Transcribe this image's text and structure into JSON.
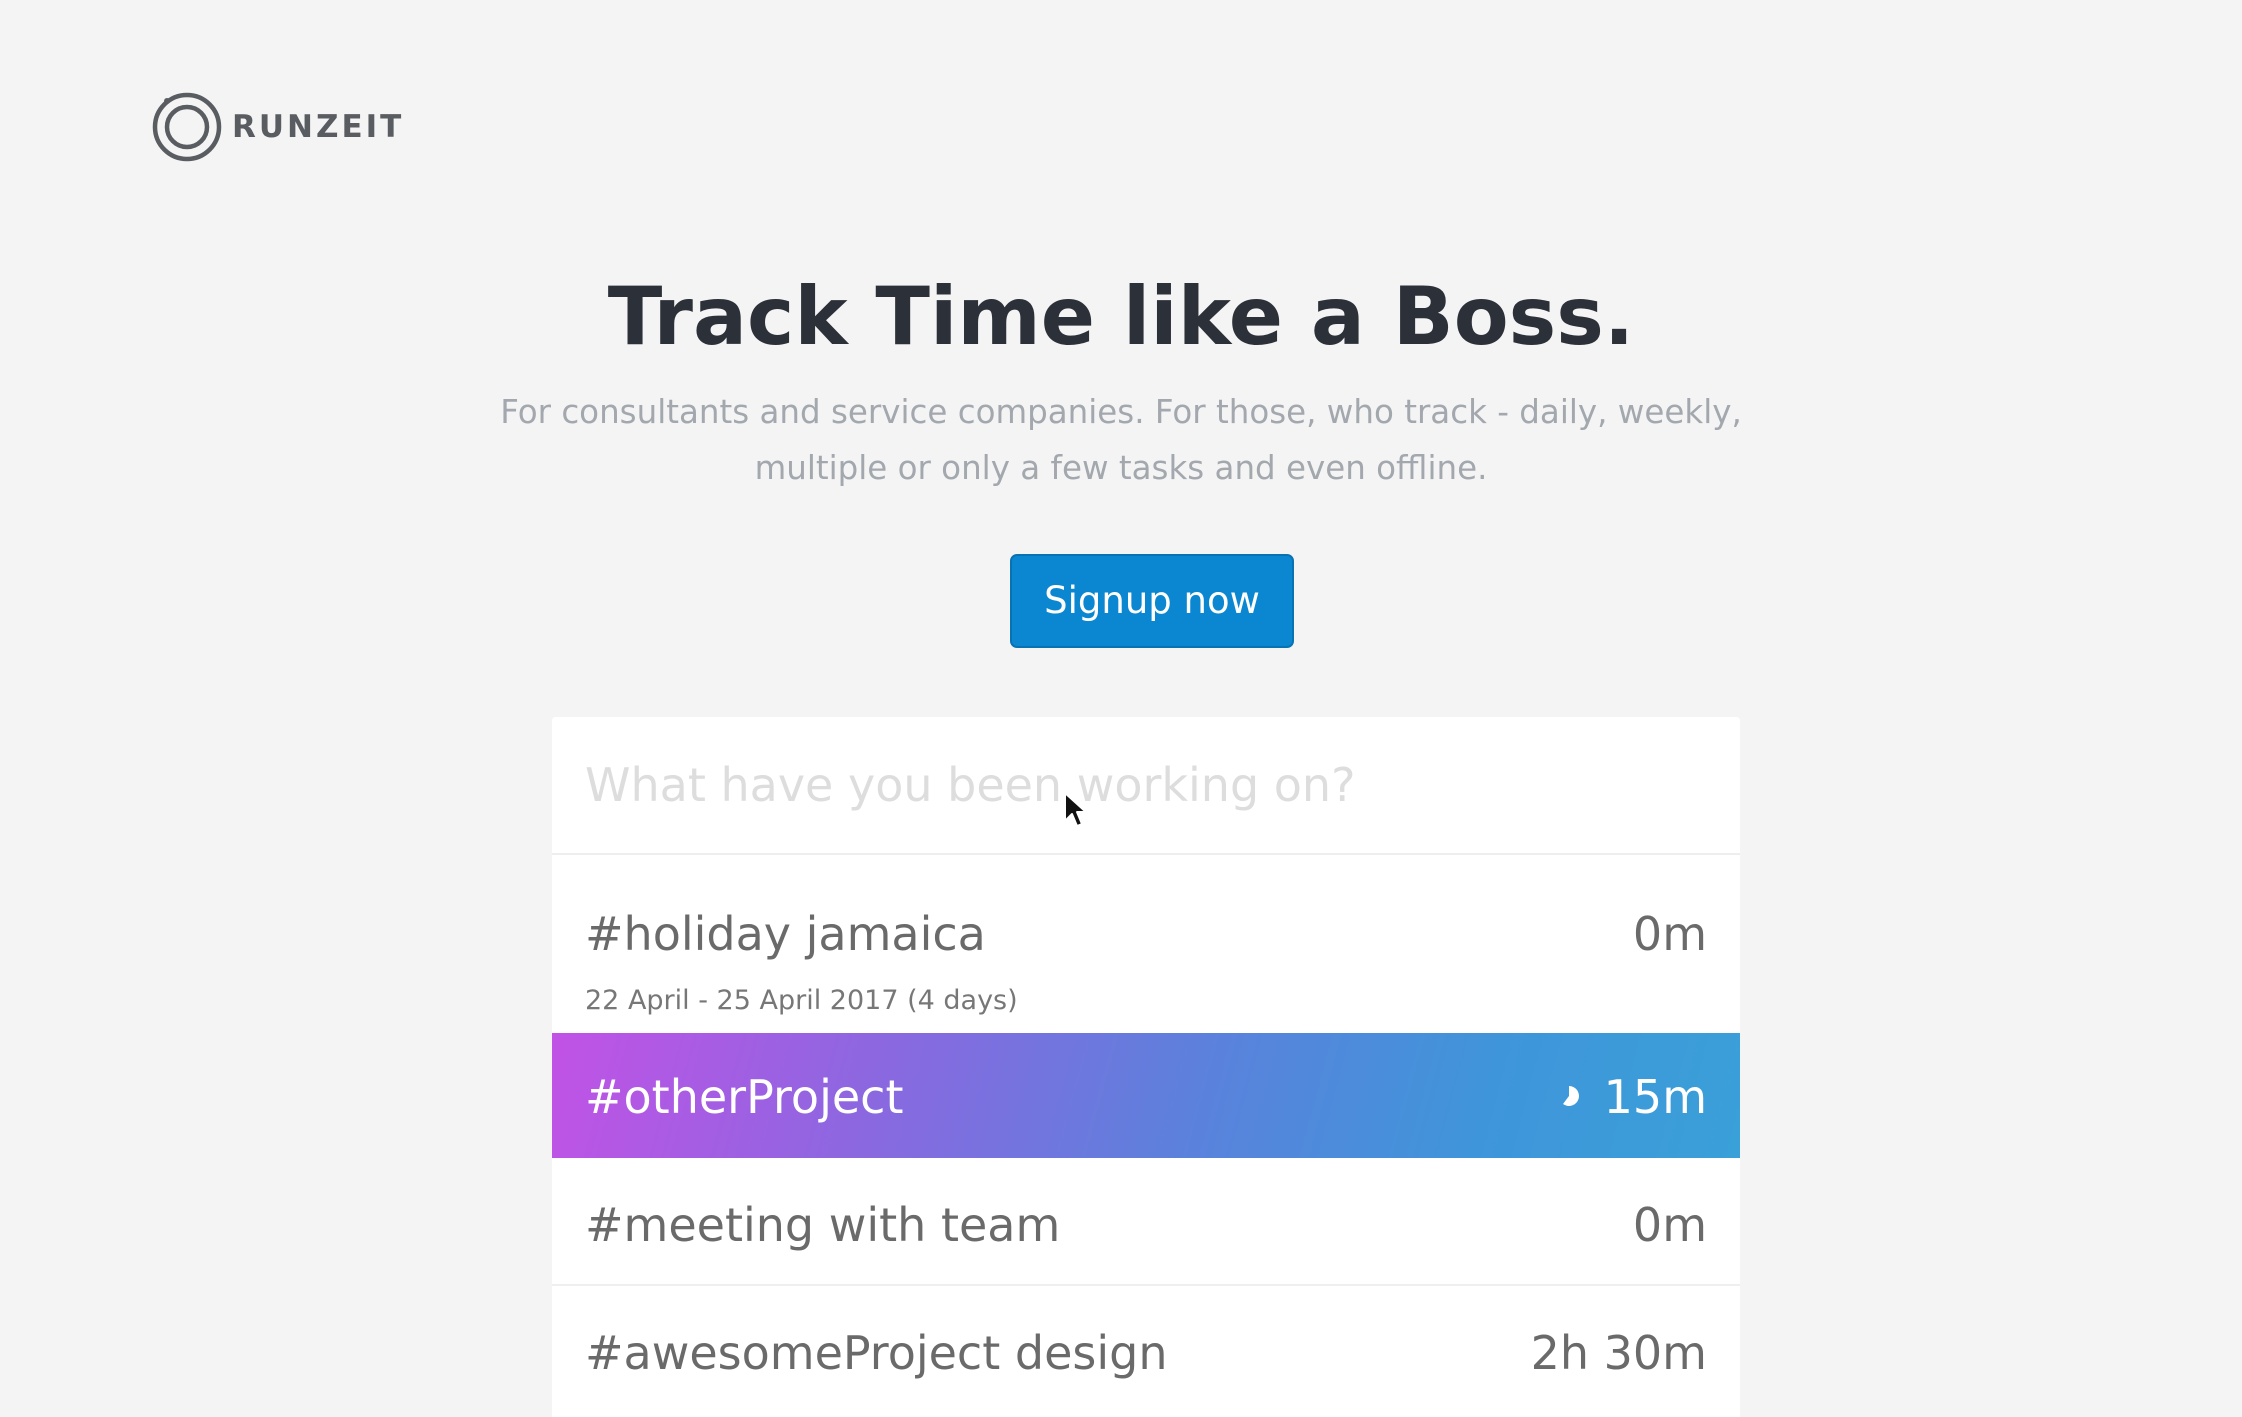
{
  "brand": {
    "name": "RUNZEIT"
  },
  "hero": {
    "title": "Track Time like a Boss.",
    "subtitle": "For consultants and service companies. For those, who track - daily, weekly, multiple or only a few tasks and even offline.",
    "cta_label": "Signup now"
  },
  "tracker": {
    "input_placeholder": "What have you been working on?",
    "entries": [
      {
        "name": "#holiday jamaica",
        "time": "0m",
        "detail": "22 April - 25 April 2017 (4 days)",
        "active": false
      },
      {
        "name": "#otherProject",
        "time": "15m",
        "active": true,
        "status_icon": "progress-pie-icon"
      },
      {
        "name": "#meeting with team",
        "time": "0m",
        "active": false
      },
      {
        "name": "#awesomeProject design",
        "time": "2h 30m",
        "active": false
      }
    ]
  },
  "colors": {
    "background": "#f4f4f4",
    "cta": "#0b87d1",
    "title": "#2c3038",
    "subtitle": "#a3a8ae",
    "active_gradient_start": "#c252e6",
    "active_gradient_end": "#3aa0d8"
  }
}
